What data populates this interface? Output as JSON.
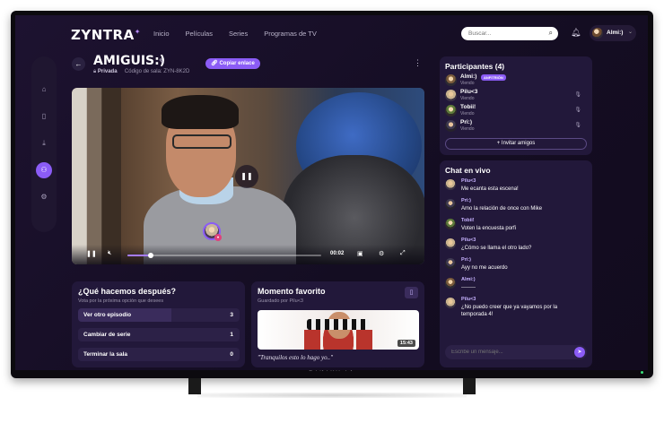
{
  "device": {
    "brand_text": "ZYNTRA TV"
  },
  "header": {
    "logo": "ZYNTRA",
    "nav": [
      "Inicio",
      "Películas",
      "Series",
      "Programas de TV"
    ],
    "search_placeholder": "Buscar...",
    "user_name": "Almi:)"
  },
  "room": {
    "title": "AMIGUIS:)",
    "privacy": "Privada",
    "code_label": "Código de sala:",
    "code": "ZYN-8K2D",
    "copy_button": "Copiar enlace"
  },
  "player": {
    "time": "00:02",
    "progress": 0.12
  },
  "poll": {
    "title": "¿Qué hacemos después?",
    "subtitle": "Vota por la próxima opción que desees",
    "options": [
      {
        "label": "Ver otro episodio",
        "count": "3",
        "share": 0.58
      },
      {
        "label": "Cambiar de serie",
        "count": "1",
        "share": 0.0
      },
      {
        "label": "Terminar la sala",
        "count": "0",
        "share": 0.0
      }
    ]
  },
  "favorite": {
    "title": "Momento favorito",
    "subtitle": "Guardado por Pilu<3",
    "timestamp": "15:43",
    "quote": "\"Tranquilos esto lo hago yo..\""
  },
  "participants": {
    "title": "Participantes (4)",
    "host_badge": "ANFITRIÓN",
    "invite_button": "Invitar amigos",
    "list": [
      {
        "name": "Almi:)",
        "status": "Viendo"
      },
      {
        "name": "Pilu<3",
        "status": "Viendo"
      },
      {
        "name": "Tobii!",
        "status": "Viendo"
      },
      {
        "name": "Pri:)",
        "status": "Viendo"
      }
    ]
  },
  "chat": {
    "title": "Chat en vivo",
    "input_placeholder": "Escribe un mensaje...",
    "messages": [
      {
        "user": "Pilu<3",
        "text": "Me ecanta esta escena!"
      },
      {
        "user": "Pri:)",
        "text": "Amo la relación de once con Mike"
      },
      {
        "user": "Tobii!",
        "text": "Voten la encuesta porfi"
      },
      {
        "user": "Pilu<3",
        "text": "¿Cómo se llama el otro lado?"
      },
      {
        "user": "Pri:)",
        "text": "Ayy no me acuerdo"
      },
      {
        "user": "Almi:)",
        "text": "--------"
      },
      {
        "user": "Pilu<3",
        "text": "¿No puedo creer que ya vayamos por la temporada 4!"
      }
    ]
  }
}
